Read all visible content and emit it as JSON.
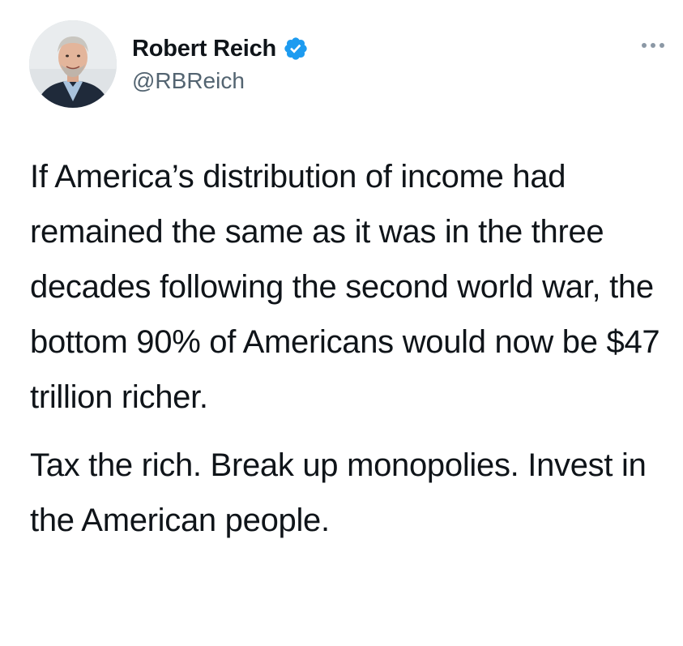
{
  "tweet": {
    "author": {
      "display_name": "Robert Reich",
      "handle": "@RBReich",
      "verified": true
    },
    "paragraphs": [
      "If America’s distribution of income had remained the same as it was in the three decades following the second world war, the bottom 90% of Americans would now be $47 trillion richer.",
      "Tax the rich. Break up monopolies. Invest in the American people."
    ]
  },
  "icons": {
    "verified": "verified-badge-icon",
    "more": "more-options-icon"
  },
  "colors": {
    "text_primary": "#0f1419",
    "text_secondary": "#536471",
    "verified_blue": "#1d9bf0"
  }
}
